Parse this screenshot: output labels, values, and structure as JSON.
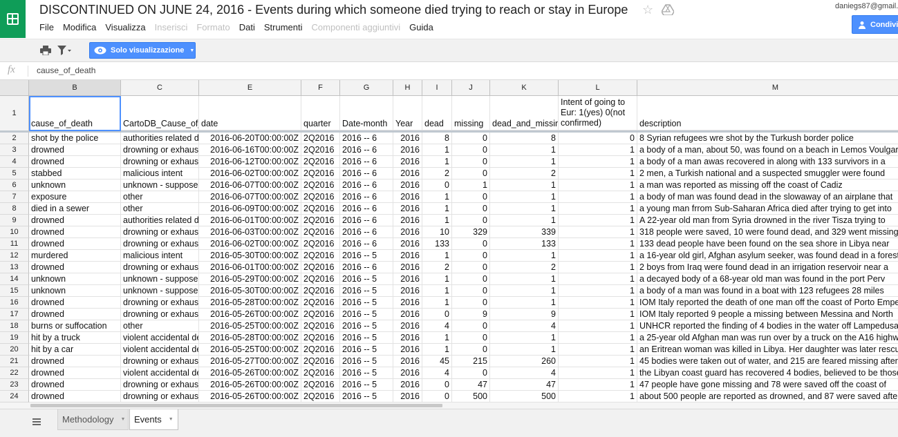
{
  "app": {
    "title": "DISCONTINUED ON JUNE 24, 2016 - Events during which someone died trying to reach or stay in Europe",
    "user": "daniegs87@gmail.",
    "share_label": "Condivi",
    "brand_color": "#0f9d58",
    "accent_color": "#4d90fe"
  },
  "menu": {
    "items": [
      {
        "label": "File",
        "disabled": false
      },
      {
        "label": "Modifica",
        "disabled": false
      },
      {
        "label": "Visualizza",
        "disabled": false
      },
      {
        "label": "Inserisci",
        "disabled": true
      },
      {
        "label": "Formato",
        "disabled": true
      },
      {
        "label": "Dati",
        "disabled": false
      },
      {
        "label": "Strumenti",
        "disabled": false
      },
      {
        "label": "Componenti aggiuntivi",
        "disabled": true
      },
      {
        "label": "Guida",
        "disabled": false
      }
    ]
  },
  "toolbar": {
    "view_only_label": "Solo visualizzazione",
    "icons": [
      "print-icon",
      "filter-icon",
      "eye-icon"
    ]
  },
  "formula_bar": {
    "fx_label": "fx",
    "value": "cause_of_death"
  },
  "sheet": {
    "columns": [
      {
        "letter": "B",
        "selected": true
      },
      {
        "letter": "C"
      },
      {
        "letter": "E"
      },
      {
        "letter": "F"
      },
      {
        "letter": "G"
      },
      {
        "letter": "H"
      },
      {
        "letter": "I"
      },
      {
        "letter": "J"
      },
      {
        "letter": "K"
      },
      {
        "letter": "L"
      },
      {
        "letter": "M"
      }
    ],
    "header_row": {
      "row_number": "1",
      "cells": [
        "cause_of_death",
        "CartoDB_Cause_of_death",
        "date",
        "quarter",
        "Date-month",
        "Year",
        "dead",
        "missing",
        "dead_and_missing",
        "Intent of going to Eur: 1(yes) 0(not confirmed)",
        "description"
      ]
    },
    "rows": [
      {
        "n": "2",
        "cells": [
          "shot by the police",
          "authorities related death",
          "2016-06-20T00:00:00Z",
          "2Q2016",
          "2016 -- 6",
          "2016",
          "8",
          "0",
          "8",
          "0",
          "8 Syrian refugees wre shot by the Turkush border police"
        ]
      },
      {
        "n": "3",
        "cells": [
          "drowned",
          "drowning or exhaustion related death",
          "2016-06-16T00:00:00Z",
          "2Q2016",
          "2016 -- 6",
          "2016",
          "1",
          "0",
          "1",
          "1",
          "a body of a man, about 50, was found on a beach in Lemos Voulgaris"
        ]
      },
      {
        "n": "4",
        "cells": [
          "drowned",
          "drowning or exhaustion related death",
          "2016-06-12T00:00:00Z",
          "2Q2016",
          "2016 -- 6",
          "2016",
          "1",
          "0",
          "1",
          "1",
          "a body of a man awas recovered in along with 133 survivors in a"
        ]
      },
      {
        "n": "5",
        "cells": [
          "stabbed",
          "malicious intent",
          "2016-06-02T00:00:00Z",
          "2Q2016",
          "2016 -- 6",
          "2016",
          "2",
          "0",
          "2",
          "1",
          "2 men, a Turkish national and a suspected smuggler were found"
        ]
      },
      {
        "n": "6",
        "cells": [
          "unknown",
          "unknown - supposedly exhaustion related death",
          "2016-06-07T00:00:00Z",
          "2Q2016",
          "2016 -- 6",
          "2016",
          "0",
          "1",
          "1",
          "1",
          "a man was reported as missing off the coast of Cadiz"
        ]
      },
      {
        "n": "7",
        "cells": [
          "exposure",
          "other",
          "2016-06-07T00:00:00Z",
          "2Q2016",
          "2016 -- 6",
          "2016",
          "1",
          "0",
          "1",
          "1",
          "a body of  man was found dead in the slowaway of an airplane that"
        ]
      },
      {
        "n": "8",
        "cells": [
          "died in a sewer",
          "other",
          "2016-06-09T00:00:00Z",
          "2Q2016",
          "2016 -- 6",
          "2016",
          "1",
          "0",
          "1",
          "1",
          "a young man frrom Sub-Saharan Africa died after trying to get into"
        ]
      },
      {
        "n": "9",
        "cells": [
          "drowned",
          "authorities related death",
          "2016-06-01T00:00:00Z",
          "2Q2016",
          "2016 -- 6",
          "2016",
          "1",
          "0",
          "1",
          "1",
          "A 22-year old man from Syria drowned in the river Tisza trying to"
        ]
      },
      {
        "n": "10",
        "cells": [
          "drowned",
          "drowning or exhaustion related death",
          "2016-06-03T00:00:00Z",
          "2Q2016",
          "2016 -- 6",
          "2016",
          "10",
          "329",
          "339",
          "1",
          "318 people were saved, 10 were found dead, and 329 went missing"
        ]
      },
      {
        "n": "11",
        "cells": [
          "drowned",
          "drowning or exhaustion related death",
          "2016-06-02T00:00:00Z",
          "2Q2016",
          "2016 -- 6",
          "2016",
          "133",
          "0",
          "133",
          "1",
          "133 dead people have been found on the sea shore in Libya near"
        ]
      },
      {
        "n": "12",
        "cells": [
          "murdered",
          "malicious intent",
          "2016-05-30T00:00:00Z",
          "2Q2016",
          "2016 -- 5",
          "2016",
          "1",
          "0",
          "1",
          "1",
          "a 16-year old girl, Afghan asylum seeker, was found dead in a forest"
        ]
      },
      {
        "n": "13",
        "cells": [
          "drowned",
          "drowning or exhaustion related death",
          "2016-06-01T00:00:00Z",
          "2Q2016",
          "2016 -- 6",
          "2016",
          "2",
          "0",
          "2",
          "1",
          "2 boys from Iraq were found dead in an irrigation reservoir near a"
        ]
      },
      {
        "n": "14",
        "cells": [
          "unknown",
          "unknown - supposedly exhaustion related death",
          "2016-05-29T00:00:00Z",
          "2Q2016",
          "2016 -- 5",
          "2016",
          "1",
          "0",
          "1",
          "1",
          "a decayed body of a 68-year old  man was found in the port Perv"
        ]
      },
      {
        "n": "15",
        "cells": [
          "unknown",
          "unknown - supposedly exhaustion related death",
          "2016-05-30T00:00:00Z",
          "2Q2016",
          "2016 -- 5",
          "2016",
          "1",
          "0",
          "1",
          "1",
          "a body of a man was found in a boat with 123 refugees 28 miles"
        ]
      },
      {
        "n": "16",
        "cells": [
          "drowned",
          "drowning or exhaustion related death",
          "2016-05-28T00:00:00Z",
          "2Q2016",
          "2016 -- 5",
          "2016",
          "1",
          "0",
          "1",
          "1",
          "IOM Italy reported the death of one man off the coast of Porto Empedocle"
        ]
      },
      {
        "n": "17",
        "cells": [
          "drowned",
          "drowning or exhaustion related death",
          "2016-05-26T00:00:00Z",
          "2Q2016",
          "2016 -- 5",
          "2016",
          "0",
          "9",
          "9",
          "1",
          "IOM Italy reported 9 people a missing between Messina and North"
        ]
      },
      {
        "n": "18",
        "cells": [
          "burns or suffocation",
          "other",
          "2016-05-25T00:00:00Z",
          "2Q2016",
          "2016 -- 5",
          "2016",
          "4",
          "0",
          "4",
          "1",
          "UNHCR reported the finding of 4 bodies in the water off Lampedusa"
        ]
      },
      {
        "n": "19",
        "cells": [
          "hit by a truck",
          "violent accidental death",
          "2016-05-28T00:00:00Z",
          "2Q2016",
          "2016 -- 5",
          "2016",
          "1",
          "0",
          "1",
          "1",
          "a 25-year old Afghan man was run over by a truck on the A16 highway"
        ]
      },
      {
        "n": "20",
        "cells": [
          "hit by a car",
          "violent accidental death",
          "2016-05-25T00:00:00Z",
          "2Q2016",
          "2016 -- 5",
          "2016",
          "1",
          "0",
          "1",
          "1",
          "an Eritrean woman was killed in Libya. Her daughter was later rescued"
        ]
      },
      {
        "n": "21",
        "cells": [
          "drowned",
          "drowning or exhaustion related death",
          "2016-05-27T00:00:00Z",
          "2Q2016",
          "2016 -- 5",
          "2016",
          "45",
          "215",
          "260",
          "1",
          "45 bodies were taken out of water, and 215 are feared missing after"
        ]
      },
      {
        "n": "22",
        "cells": [
          "drowned",
          "violent accidental death",
          "2016-05-26T00:00:00Z",
          "2Q2016",
          "2016 -- 5",
          "2016",
          "4",
          "0",
          "4",
          "1",
          "the Libyan coast guard has recovered 4 bodies, believed to be those"
        ]
      },
      {
        "n": "23",
        "cells": [
          "drowned",
          "drowning or exhaustion related death",
          "2016-05-26T00:00:00Z",
          "2Q2016",
          "2016 -- 5",
          "2016",
          "0",
          "47",
          "47",
          "1",
          "47 people have gone missing and 78 were saved off the coast of"
        ]
      },
      {
        "n": "24",
        "cells": [
          "drowned",
          "drowning or exhaustion related death",
          "2016-05-26T00:00:00Z",
          "2Q2016",
          "2016 -- 5",
          "2016",
          "0",
          "500",
          "500",
          "1",
          "about 500 people are reported as drowned, and 87 were saved after"
        ]
      }
    ]
  },
  "tabs": [
    {
      "label": "Methodology",
      "active": false
    },
    {
      "label": "Events",
      "active": true
    }
  ]
}
